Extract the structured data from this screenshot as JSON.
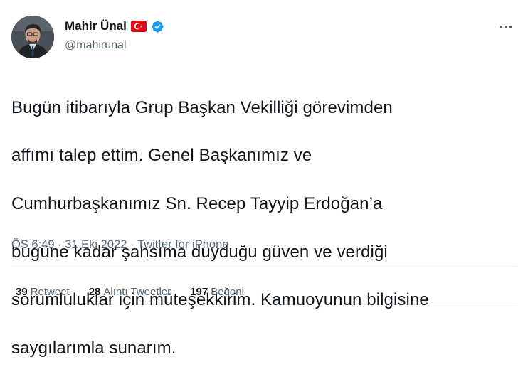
{
  "author": {
    "display_name": "Mahir Ünal",
    "handle": "@mahirunal",
    "flag": "turkey-flag",
    "verified": "verified-badge-icon"
  },
  "tweet": {
    "text_lines": [
      "Bugün itibarıyla Grup Başkan Vekilliği görevimden",
      "affımı talep ettim. Genel Başkanımız ve",
      "Cumhurbaşkanımız Sn. Recep Tayyip Erdoğan’a",
      "bugüne kadar  şahsıma duyduğu güven ve verdiği",
      "sorumluluklar için müteşekkirim. Kamuoyunun bilgisine",
      "saygılarımla sunarım."
    ],
    "time": "ÖS 6:49",
    "separator": " · ",
    "date": "31 Eki 2022",
    "source": "Twitter for iPhone"
  },
  "stats": {
    "retweets": {
      "count": "39",
      "label": "Retweet"
    },
    "quotes": {
      "count": "28",
      "label": "Alıntı Tweetler"
    },
    "likes": {
      "count": "197",
      "label": "Beğeni"
    }
  },
  "colors": {
    "text": "#0f1419",
    "secondary": "#536471",
    "verified": "#1d9bf0",
    "flag_red": "#e30a17"
  }
}
